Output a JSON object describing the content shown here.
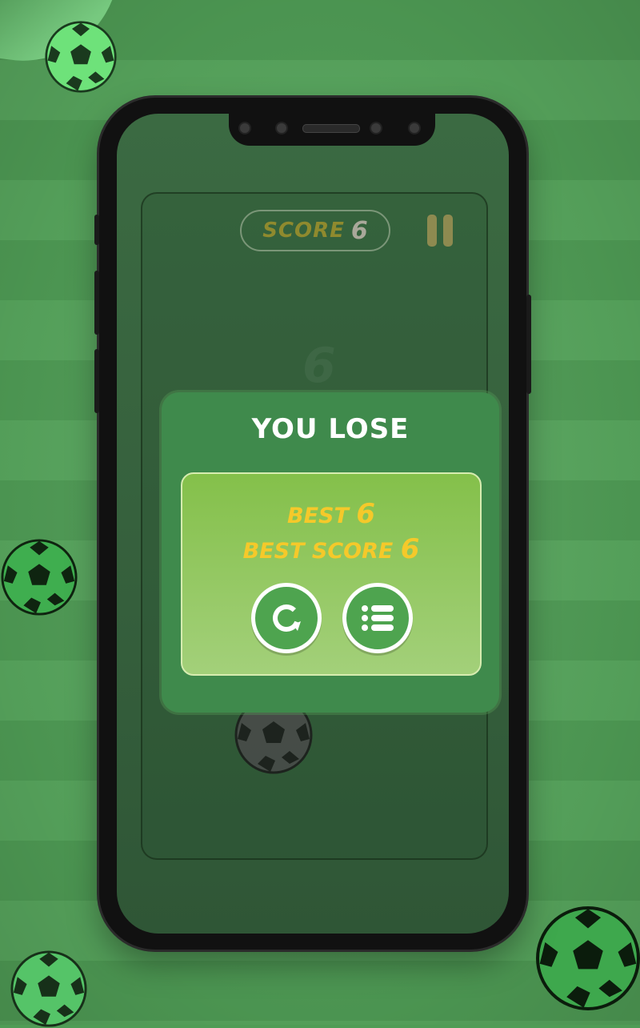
{
  "score": {
    "label": "SCORE",
    "value": "6"
  },
  "dialog": {
    "title": "YOU LOSE",
    "best_label": "BEST",
    "best_value": "6",
    "best_score_label": "BEST SCORE",
    "best_score_value": "6"
  },
  "icons": {
    "pause": "pause-icon",
    "restart": "restart-icon",
    "menu": "list-icon",
    "ball": "soccer-ball-icon"
  },
  "colors": {
    "field_dark": "#4f9c55",
    "field_light": "#58a75e",
    "dialog": "#3f8a4c",
    "panel": "#84c04a",
    "accent_yellow": "#f5c92a",
    "button_green": "#4ea44f"
  }
}
